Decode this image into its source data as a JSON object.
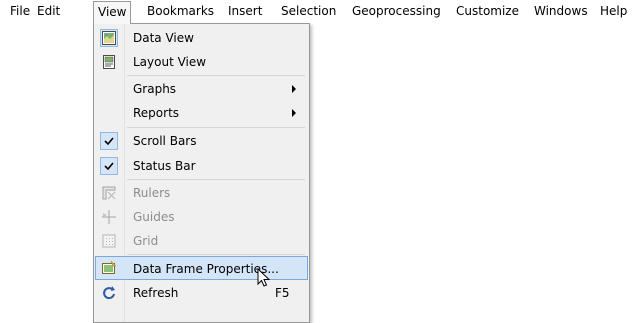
{
  "menubar": {
    "items": [
      "File",
      "Edit",
      "View",
      "Bookmarks",
      "Insert",
      "Selection",
      "Geoprocessing",
      "Customize",
      "Windows",
      "Help"
    ]
  },
  "view_menu": {
    "items": [
      {
        "label": "Data View",
        "icon": "data-view-icon",
        "checked": true
      },
      {
        "label": "Layout View",
        "icon": "layout-view-icon"
      },
      {
        "label": "Graphs",
        "submenu": true
      },
      {
        "label": "Reports",
        "submenu": true
      },
      {
        "label": "Scroll Bars",
        "checked": true
      },
      {
        "label": "Status Bar",
        "checked": true
      },
      {
        "label": "Rulers",
        "icon": "rulers-icon",
        "disabled": true
      },
      {
        "label": "Guides",
        "icon": "guides-icon",
        "disabled": true
      },
      {
        "label": "Grid",
        "icon": "grid-icon",
        "disabled": true
      },
      {
        "label": "Data Frame Properties...",
        "icon": "data-frame-properties-icon",
        "highlighted": true
      },
      {
        "label": "Refresh",
        "icon": "refresh-icon",
        "shortcut": "F5"
      }
    ]
  },
  "colors": {
    "highlight": "#d5e5f8",
    "highlight_border": "#7da7d8",
    "disabled_text": "#8d8d8d",
    "menu_bg": "#f0f0f0"
  }
}
